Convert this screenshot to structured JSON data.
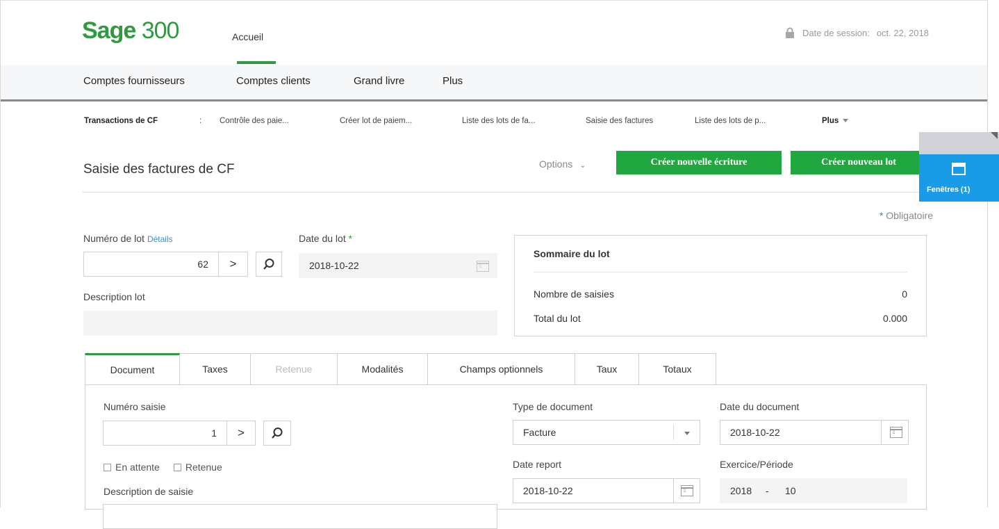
{
  "header": {
    "logo_brand": "Sage",
    "logo_number": "300",
    "home_tab": "Accueil",
    "session_label": "Date de session:",
    "session_date": "oct. 22, 2018"
  },
  "module_nav": [
    "Comptes fournisseurs",
    "Comptes clients",
    "Grand livre",
    "Plus"
  ],
  "sub_nav": {
    "section": "Transactions de CF",
    "separator": ":",
    "items": [
      "Contrôle des paie...",
      "Créer lot de paiem...",
      "Liste des lots de fa...",
      "Saisie des factures",
      "Liste des lots de p..."
    ],
    "more": "Plus"
  },
  "page": {
    "title": "Saisie des factures de CF",
    "options": "Options",
    "btn_new_entry": "Créer nouvelle écriture",
    "btn_new_batch": "Créer nouveau lot",
    "required_star": "*",
    "required_note": "Obligatoire"
  },
  "windows_tab": {
    "label": "Fenêtres (1)",
    "icon": "window-icon"
  },
  "batch": {
    "number_label": "Numéro de lot",
    "details_link": "Détails",
    "number_value": "62",
    "date_label": "Date du lot",
    "date_required": "*",
    "date_value": "2018-10-22",
    "description_label": "Description lot",
    "description_value": ""
  },
  "summary": {
    "title": "Sommaire du lot",
    "entries_label": "Nombre de saisies",
    "entries_value": "0",
    "total_label": "Total du lot",
    "total_value": "0.000"
  },
  "tabs": [
    {
      "label": "Document",
      "state": "active"
    },
    {
      "label": "Taxes",
      "state": "normal"
    },
    {
      "label": "Retenue",
      "state": "disabled"
    },
    {
      "label": "Modalités",
      "state": "normal"
    },
    {
      "label": "Champs optionnels",
      "state": "normal"
    },
    {
      "label": "Taux",
      "state": "normal"
    },
    {
      "label": "Totaux",
      "state": "normal"
    }
  ],
  "document": {
    "entry_number_label": "Numéro saisie",
    "entry_number_value": "1",
    "on_hold_label": "En attente",
    "retention_label": "Retenue",
    "entry_description_label": "Description de saisie",
    "doc_type_label": "Type de document",
    "doc_type_value": "Facture",
    "doc_date_label": "Date du document",
    "doc_date_value": "2018-10-22",
    "posting_date_label": "Date report",
    "posting_date_value": "2018-10-22",
    "period_label": "Exercice/Période",
    "period_year": "2018",
    "period_sep": "-",
    "period_value": "10"
  },
  "colors": {
    "brand_green": "#2e9b3e",
    "button_green": "#21a73f",
    "windows_blue": "#1a9be8"
  }
}
